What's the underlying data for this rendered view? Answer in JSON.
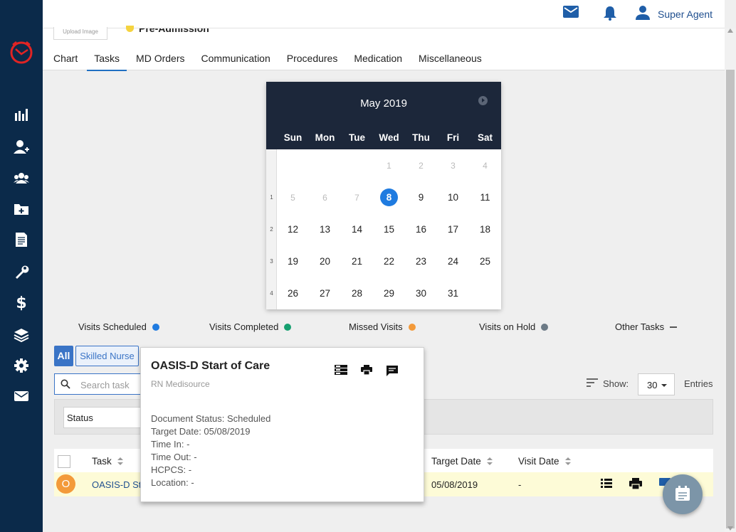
{
  "topbar": {
    "user_name": "Super Agent"
  },
  "patient": {
    "upload_label": "Upload Image",
    "status": "Pre-Admission"
  },
  "tabs": [
    {
      "label": "Chart"
    },
    {
      "label": "Tasks"
    },
    {
      "label": "MD Orders"
    },
    {
      "label": "Communication"
    },
    {
      "label": "Procedures"
    },
    {
      "label": "Medication"
    },
    {
      "label": "Miscellaneous"
    }
  ],
  "calendar": {
    "title": "May 2019",
    "dow": [
      "Sun",
      "Mon",
      "Tue",
      "Wed",
      "Thu",
      "Fri",
      "Sat"
    ],
    "weeks": [
      {
        "num": "",
        "days": [
          "",
          "",
          "",
          "1",
          "2",
          "3",
          "4"
        ]
      },
      {
        "num": "1",
        "days": [
          "5",
          "6",
          "7",
          "8",
          "9",
          "10",
          "11"
        ]
      },
      {
        "num": "2",
        "days": [
          "12",
          "13",
          "14",
          "15",
          "16",
          "17",
          "18"
        ]
      },
      {
        "num": "3",
        "days": [
          "19",
          "20",
          "21",
          "22",
          "23",
          "24",
          "25"
        ]
      },
      {
        "num": "4",
        "days": [
          "26",
          "27",
          "28",
          "29",
          "30",
          "31",
          ""
        ]
      }
    ],
    "today": "8"
  },
  "legend": [
    {
      "label": "Visits Scheduled",
      "color": "#1f7be0"
    },
    {
      "label": "Visits Completed",
      "color": "#16a070"
    },
    {
      "label": "Missed Visits",
      "color": "#f39a3a"
    },
    {
      "label": "Visits on Hold",
      "color": "#6c7a86"
    },
    {
      "label": "Other Tasks",
      "color": "#555555"
    }
  ],
  "filters": {
    "all": "All",
    "skilled_nurse": "Skilled Nurse",
    "search_placeholder": "Search task",
    "status": "Status"
  },
  "show": {
    "label": "Show:",
    "value": "30",
    "entries": "Entries"
  },
  "table": {
    "headers": {
      "task": "Task",
      "target_date": "Target Date",
      "visit_date": "Visit Date"
    },
    "row": {
      "badge": "O",
      "task": "OASIS-D Start of Care",
      "target_date": "05/08/2019",
      "visit_date": "-"
    }
  },
  "popup": {
    "title": "OASIS-D Start of Care",
    "subtitle": "RN Medisource",
    "lines": [
      "Document Status: Scheduled",
      "Target Date: 05/08/2019",
      "Time In: -",
      "Time Out: -",
      "HCPCS: -",
      "Location: -"
    ]
  }
}
